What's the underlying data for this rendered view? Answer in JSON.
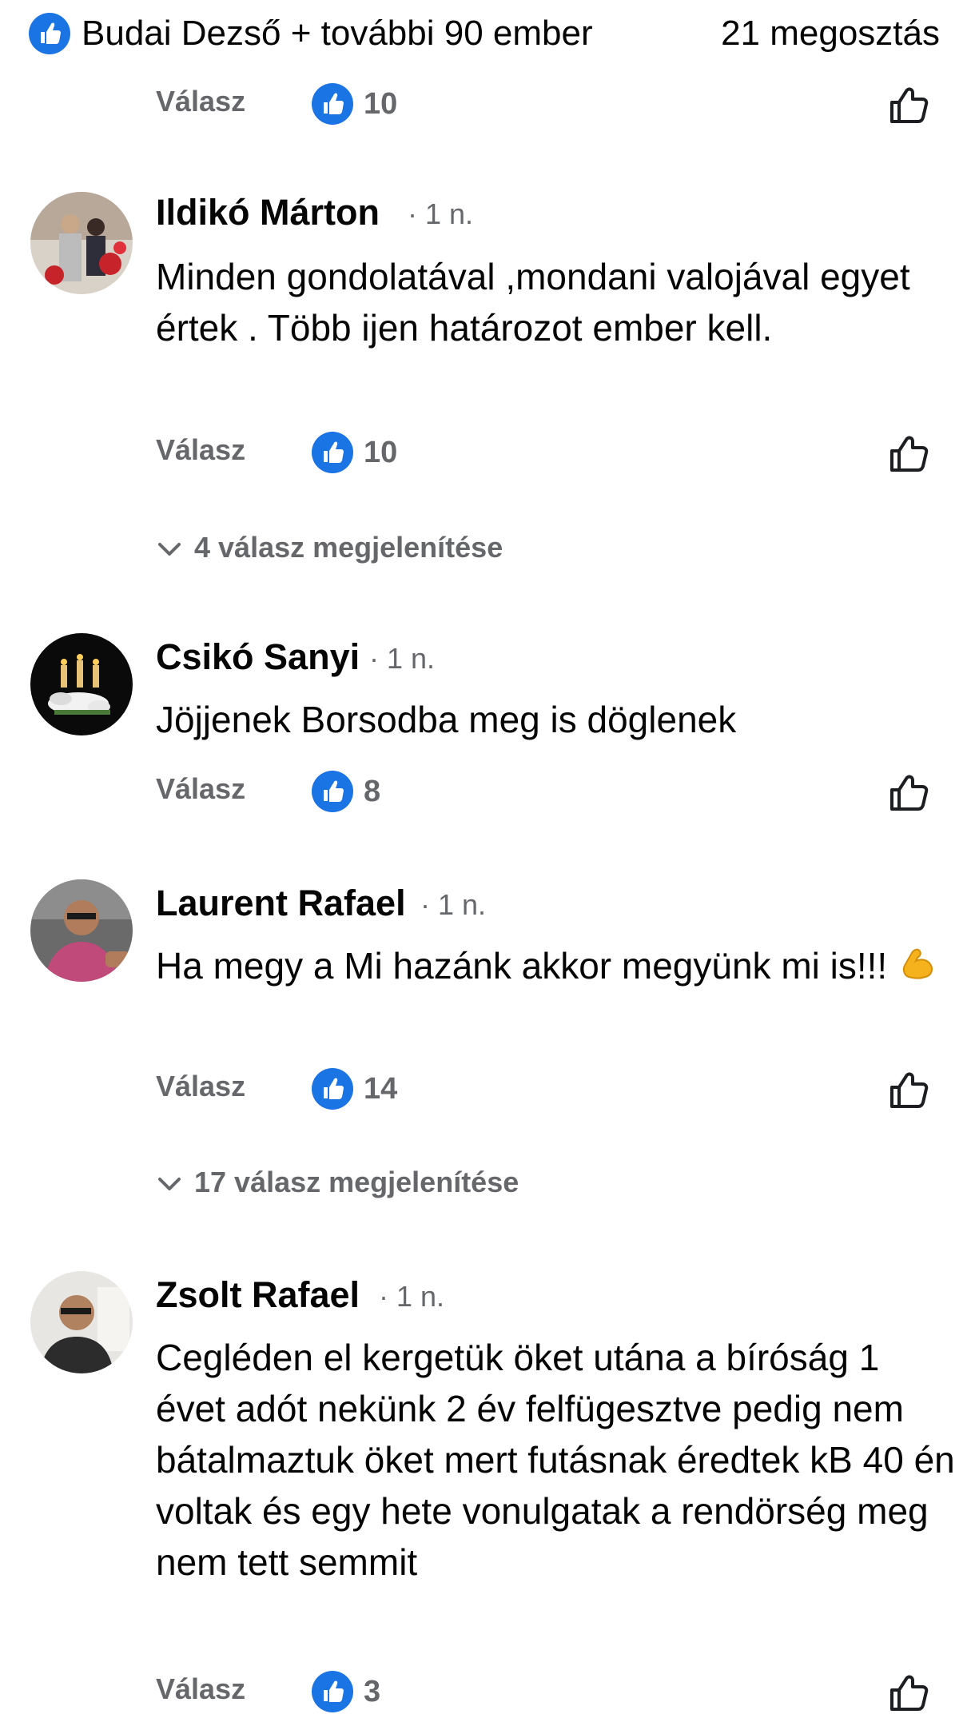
{
  "summary": {
    "likers": "Budai Dezső + további 90 ember",
    "shares": "21 megosztás"
  },
  "labels": {
    "reply": "Válasz"
  },
  "comments": [
    {
      "author": "",
      "time": "",
      "text": "",
      "reactions": "10"
    },
    {
      "author": "Ildikó Márton",
      "time": "· 1 n.",
      "text": "Minden gondolatával ,mondani valojával egyet értek . Több ijen határozot ember kell.",
      "reactions": "10",
      "view_replies": "4 válasz megjelenítése"
    },
    {
      "author": "Csikó Sanyi",
      "time": "· 1 n.",
      "text": "Jöjjenek Borsodba meg is döglenek",
      "reactions": "8"
    },
    {
      "author": "Laurent Rafael",
      "time": "· 1 n.",
      "text": "Ha megy a Mi hazánk akkor megyünk mi is!!!",
      "emoji": "flexed-biceps-emoji",
      "reactions": "14",
      "view_replies": "17 válasz megjelenítése"
    },
    {
      "author": "Zsolt Rafael",
      "time": "· 1 n.",
      "text": "Cegléden el kergetük öket utána a bíróság 1 évet adót nekünk 2 év felfügesztve pedig nem  bátalmaztuk öket mert futásnak éredtek kB 40 én voltak és egy hete vonulgatak a rendörség meg nem tett semmit",
      "reactions": "3"
    }
  ],
  "colors": {
    "accent": "#1b74e4",
    "secondary_text": "#65676b",
    "primary_text": "#050505"
  }
}
